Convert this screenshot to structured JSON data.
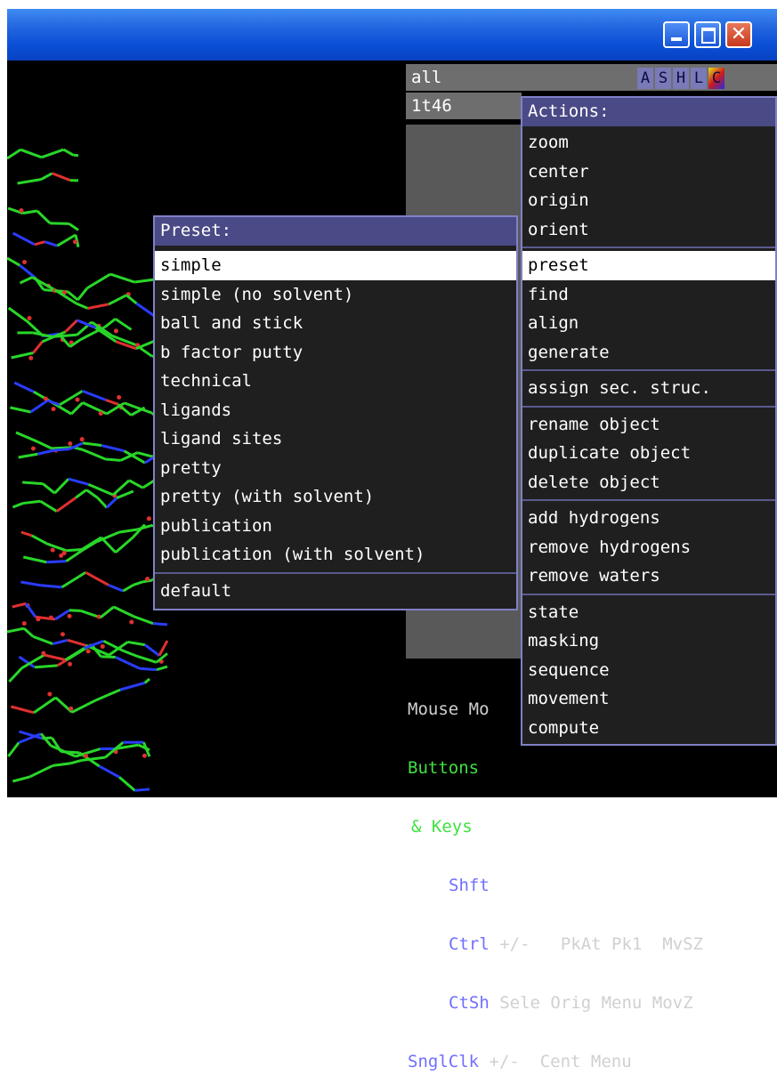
{
  "titlebar": {
    "min_icon": "minimize-icon",
    "max_icon": "maximize-icon",
    "close_icon": "close-icon",
    "close_glyph": "✕"
  },
  "panel": {
    "row_all": "all",
    "row_object": "1t46",
    "asl_buttons": [
      "A",
      "S",
      "H",
      "L",
      "C"
    ]
  },
  "actions_menu": {
    "title": "Actions:",
    "groups": [
      [
        "zoom",
        "center",
        "origin",
        "orient"
      ],
      [
        "preset",
        "find",
        "align",
        "generate"
      ],
      [
        "assign sec. struc."
      ],
      [
        "rename object",
        "duplicate object",
        "delete object"
      ],
      [
        "add hydrogens",
        "remove hydrogens",
        "remove waters"
      ],
      [
        "state",
        "masking",
        "sequence",
        "movement",
        "compute"
      ]
    ],
    "selected": "preset"
  },
  "preset_menu": {
    "title": "Preset:",
    "items": [
      "simple",
      "simple (no solvent)",
      "ball and stick",
      "b factor putty",
      "technical",
      "ligands",
      "ligand sites",
      "pretty",
      "pretty (with solvent)",
      "publication",
      "publication (with solvent)"
    ],
    "footer": "default",
    "selected": "simple"
  },
  "mouse_mode": {
    "line1": "Mouse Mo",
    "buttons": "Buttons",
    "keys": "& Keys",
    "shft": "Shft",
    "ctrl": "Ctrl",
    "ctrl_vals": "+/-   PkAt Pk1  MvSZ",
    "ctsh": "CtSh",
    "ctsh_vals": "Sele Orig Menu MovZ",
    "sngl": "SnglClk",
    "sngl_vals": "+/-  Cent Menu"
  },
  "colors": {
    "menu_title": "#4a4a86",
    "menu_border": "#8080c8",
    "title_blue": "#0a4fd6",
    "close_red": "#c7381b"
  }
}
